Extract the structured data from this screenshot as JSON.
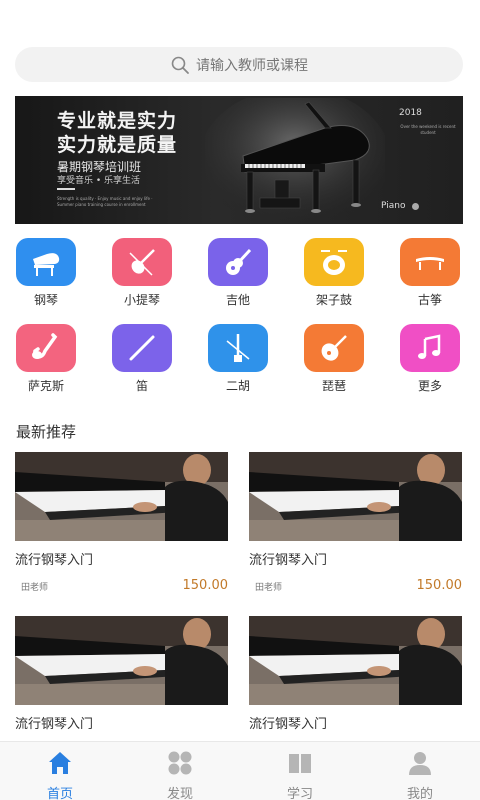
{
  "search": {
    "placeholder": "请输入教师或课程"
  },
  "banner": {
    "line1": "专业就是实力",
    "line2": "实力就是质量",
    "course": "暑期钢琴培训班",
    "tagline": "享受音乐 • 乐享生活",
    "small_en": "Strength is quality · Enjoy music and enjoy life · Summer piano training course in enrollment",
    "year": "2018",
    "right_en": "Over the weekend is recent student",
    "brand": "Piano"
  },
  "categories": [
    {
      "label": "钢琴",
      "icon": "piano-icon",
      "color": "#2f8fef"
    },
    {
      "label": "小提琴",
      "icon": "violin-icon",
      "color": "#f2607b"
    },
    {
      "label": "吉他",
      "icon": "guitar-icon",
      "color": "#7a63ea"
    },
    {
      "label": "架子鼓",
      "icon": "drum-icon",
      "color": "#f6b91f"
    },
    {
      "label": "古筝",
      "icon": "guzheng-icon",
      "color": "#f47a35"
    },
    {
      "label": "萨克斯",
      "icon": "saxophone-icon",
      "color": "#f3647f"
    },
    {
      "label": "笛",
      "icon": "flute-icon",
      "color": "#7c63ea"
    },
    {
      "label": "二胡",
      "icon": "erhu-icon",
      "color": "#2f92ea"
    },
    {
      "label": "琵琶",
      "icon": "pipa-icon",
      "color": "#f47a35"
    },
    {
      "label": "更多",
      "icon": "music-note-icon",
      "color": "#f04fc5"
    }
  ],
  "section_title": "最新推荐",
  "courses": [
    {
      "title": "流行钢琴入门",
      "teacher": "田老师",
      "price": "150.00"
    },
    {
      "title": "流行钢琴入门",
      "teacher": "田老师",
      "price": "150.00"
    },
    {
      "title": "流行钢琴入门",
      "teacher": "",
      "price": ""
    },
    {
      "title": "流行钢琴入门",
      "teacher": "",
      "price": ""
    }
  ],
  "tabs": [
    {
      "label": "首页",
      "icon": "home-icon",
      "active": true
    },
    {
      "label": "发现",
      "icon": "discover-icon",
      "active": false
    },
    {
      "label": "学习",
      "icon": "book-icon",
      "active": false
    },
    {
      "label": "我的",
      "icon": "user-icon",
      "active": false
    }
  ],
  "colors": {
    "accent": "#2a7fe0",
    "price": "#c27a2a"
  }
}
